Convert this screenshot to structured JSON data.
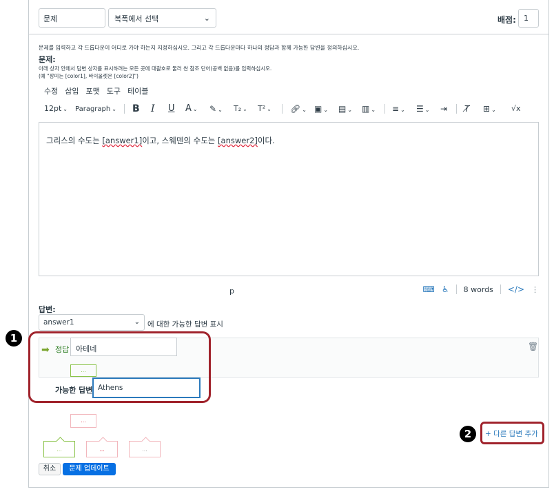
{
  "header": {
    "question_title": "문제",
    "question_type": "복폭에서 선택",
    "points_label": "배점:",
    "points_value": "1"
  },
  "instructions": "문제를 입력하고 각 드롭다운이 어디로 가야 하는지 지정하십시오. 그리고 각 드롭다운마다 하나의 정답과 함께 가능한 답변을 정의하십시오.",
  "question_section": {
    "label": "문제:",
    "hint1": "아래 상자 안에서 답변 상자를 표시하려는 모든 곳에 대괄호로 둘러 싼 참조 단어(공백 없음)를 입력하십시오.",
    "hint2": "(예 \"장미는 [color1], 바이올렛은 [color2]\")"
  },
  "editor": {
    "menu": [
      "수정",
      "삽입",
      "포맷",
      "도구",
      "테이블"
    ],
    "font_size": "12pt",
    "block_format": "Paragraph",
    "content_before": "그리스의 수도는 ",
    "ref1": "[answer1]",
    "content_mid": "이고, 스웨덴의 수도는 ",
    "ref2": "[answer2]",
    "content_after": "이다.",
    "status_path": "p",
    "word_count": "8 words"
  },
  "answers": {
    "label": "답변:",
    "selected": "answer1",
    "selector_desc": "에 대한 가능한 답변 표시",
    "correct_label": "정답",
    "correct_value": "아테네",
    "possible_label": "가능한 답변",
    "possible_value": "Athens",
    "dots": "...",
    "add_answer": "+ 다른 답변 추가"
  },
  "buttons": {
    "cancel": "취소",
    "update": "문제 업데이트"
  },
  "annotations": {
    "badge1": "1",
    "badge2": "2",
    "outline_color": "#a0232c"
  }
}
